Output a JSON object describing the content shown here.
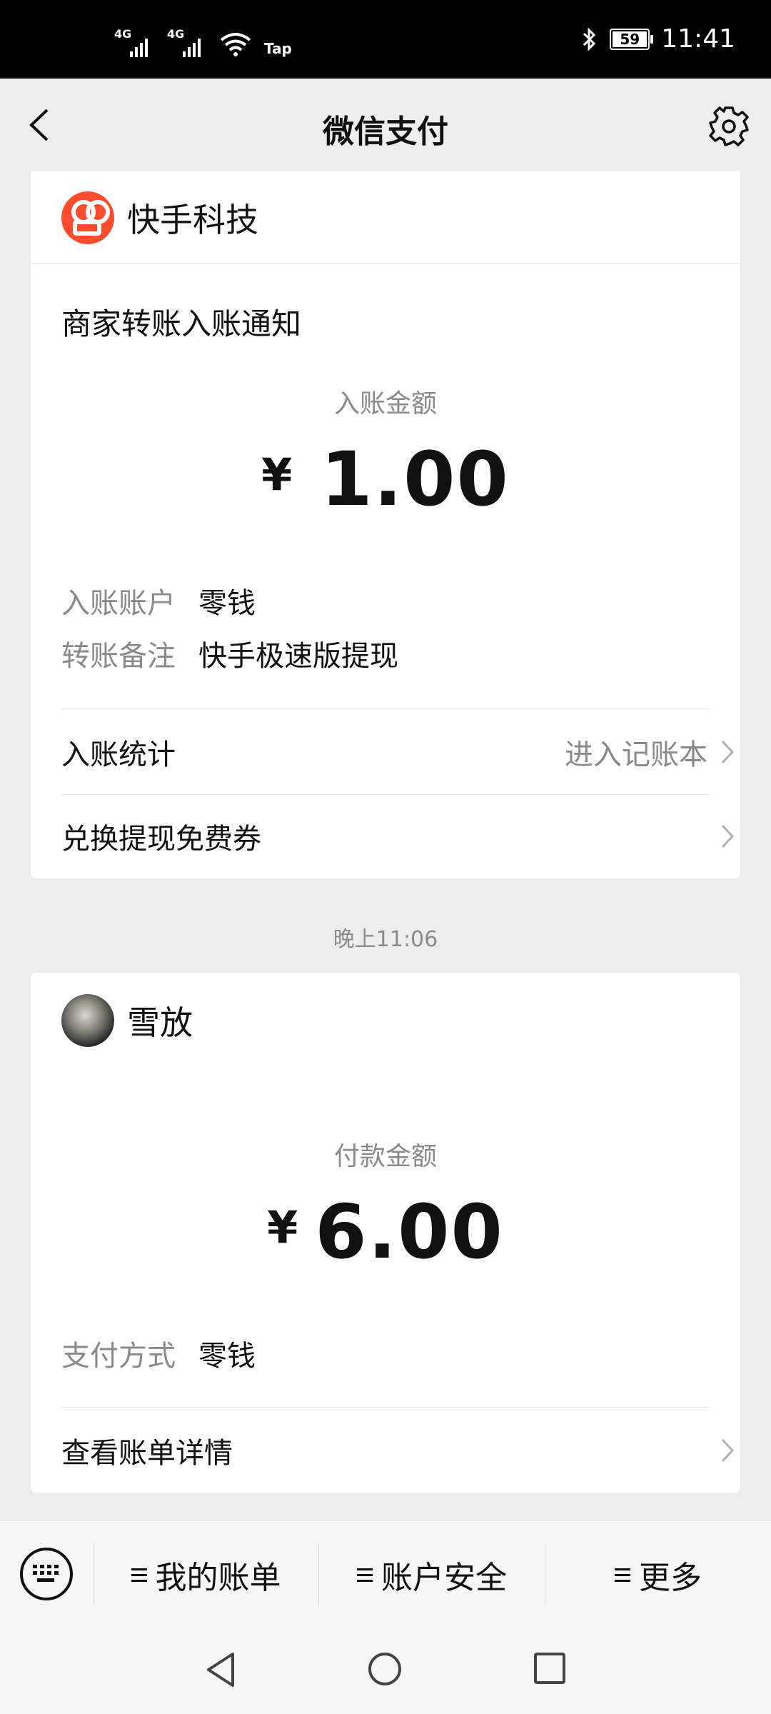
{
  "status_bar": {
    "net1": "4G",
    "net2": "4G",
    "tap_label": "Tap",
    "battery": "59",
    "time": "11:41"
  },
  "nav": {
    "title": "微信支付",
    "back_icon": "chevron-left-icon",
    "settings_icon": "gear-icon"
  },
  "card1": {
    "merchant": "快手科技",
    "notice_title": "商家转账入账通知",
    "amount_label": "入账金额",
    "currency": "¥",
    "amount": "1.00",
    "fields": [
      {
        "key": "入账账户",
        "value": "零钱"
      },
      {
        "key": "转账备注",
        "value": "快手极速版提现"
      }
    ],
    "rows": [
      {
        "label": "入账统计",
        "hint": "进入记账本"
      },
      {
        "label": "兑换提现免费券",
        "hint": ""
      }
    ]
  },
  "timestamp": "晚上11:06",
  "card2": {
    "payee": "雪放",
    "amount_label": "付款金额",
    "currency": "¥",
    "amount": "6.00",
    "fields": [
      {
        "key": "支付方式",
        "value": "零钱"
      }
    ],
    "rows": [
      {
        "label": "查看账单详情"
      }
    ]
  },
  "bottom_menu": {
    "items": [
      "我的账单",
      "账户安全",
      "更多"
    ]
  }
}
